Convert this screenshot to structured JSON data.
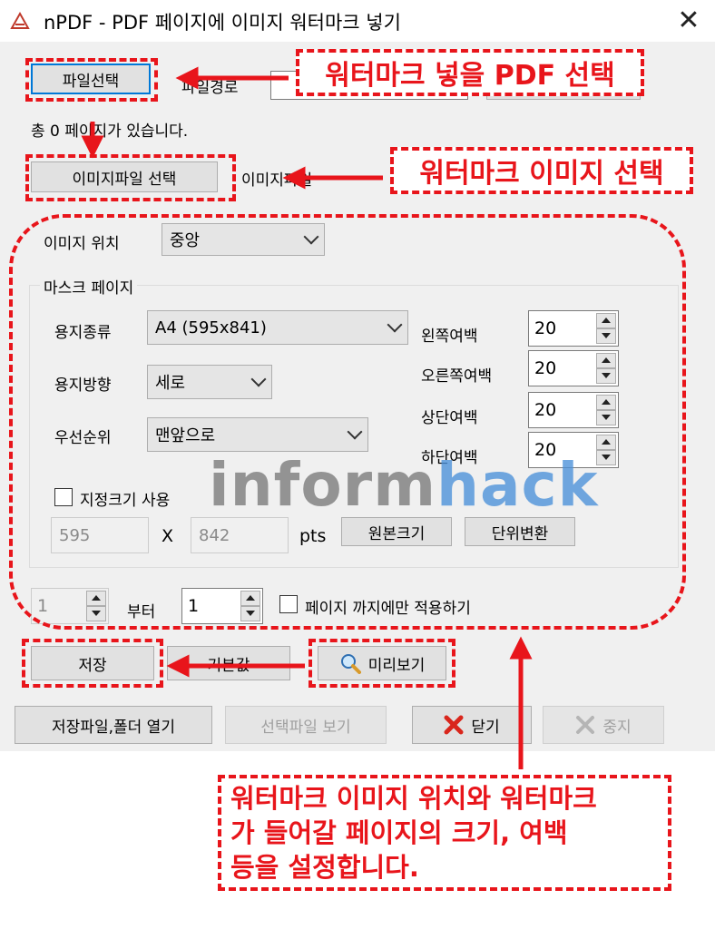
{
  "window": {
    "title": "nPDF - PDF 페이지에 이미지 워터마크 넣기",
    "close_glyph": "✕"
  },
  "file": {
    "select_pdf_button": "파일선택",
    "file_label": "파일경로",
    "page_count_text": "총 0 페이지가 있습니다.",
    "select_image_button": "이미지파일 선택",
    "image_label": "이미지파일"
  },
  "position": {
    "label": "이미지 위치",
    "value": "중앙"
  },
  "mask_page": {
    "group_title": "마스크 페이지",
    "paper_type_label": "용지종류",
    "paper_type_value": "A4 (595x841)",
    "orientation_label": "용지방향",
    "orientation_value": "세로",
    "priority_label": "우선순위",
    "priority_value": "맨앞으로",
    "margins": [
      {
        "label": "왼쪽여백",
        "value": "20"
      },
      {
        "label": "오른쪽여백",
        "value": "20"
      },
      {
        "label": "상단여백",
        "value": "20"
      },
      {
        "label": "하단여백",
        "value": "20"
      }
    ],
    "custom_size_label": "지정크기 사용",
    "custom_width": "595",
    "x_label": "X",
    "custom_height": "842",
    "unit_label": "pts",
    "original_size_button": "원본크기",
    "unit_convert_button": "단위변환"
  },
  "range": {
    "from_value": "1",
    "from_label": "부터",
    "to_value": "1",
    "only_label": "페이지 까지에만 적용하기"
  },
  "actions": {
    "save": "저장",
    "default": "기본값",
    "preview": "미리보기",
    "open_folder": "저장파일,폴더 열기",
    "view_selected": "선택파일 보기",
    "close": "닫기",
    "stop": "중지"
  },
  "watermark_text": {
    "part1": "inform",
    "part2": "hack",
    "color1": "#7a7a7a",
    "color2": "#4a90d9"
  },
  "annotations": {
    "callout_pdf": "워터마크 넣을 PDF 선택",
    "callout_image": "워터마크 이미지 선택",
    "callout_settings_line1": "워터마크 이미지 위치와 워터마크",
    "callout_settings_line2": "가 들어갈 페이지의 크기, 여백",
    "callout_settings_line3": "등을 설정합니다.",
    "accent_color": "#e8151b"
  }
}
